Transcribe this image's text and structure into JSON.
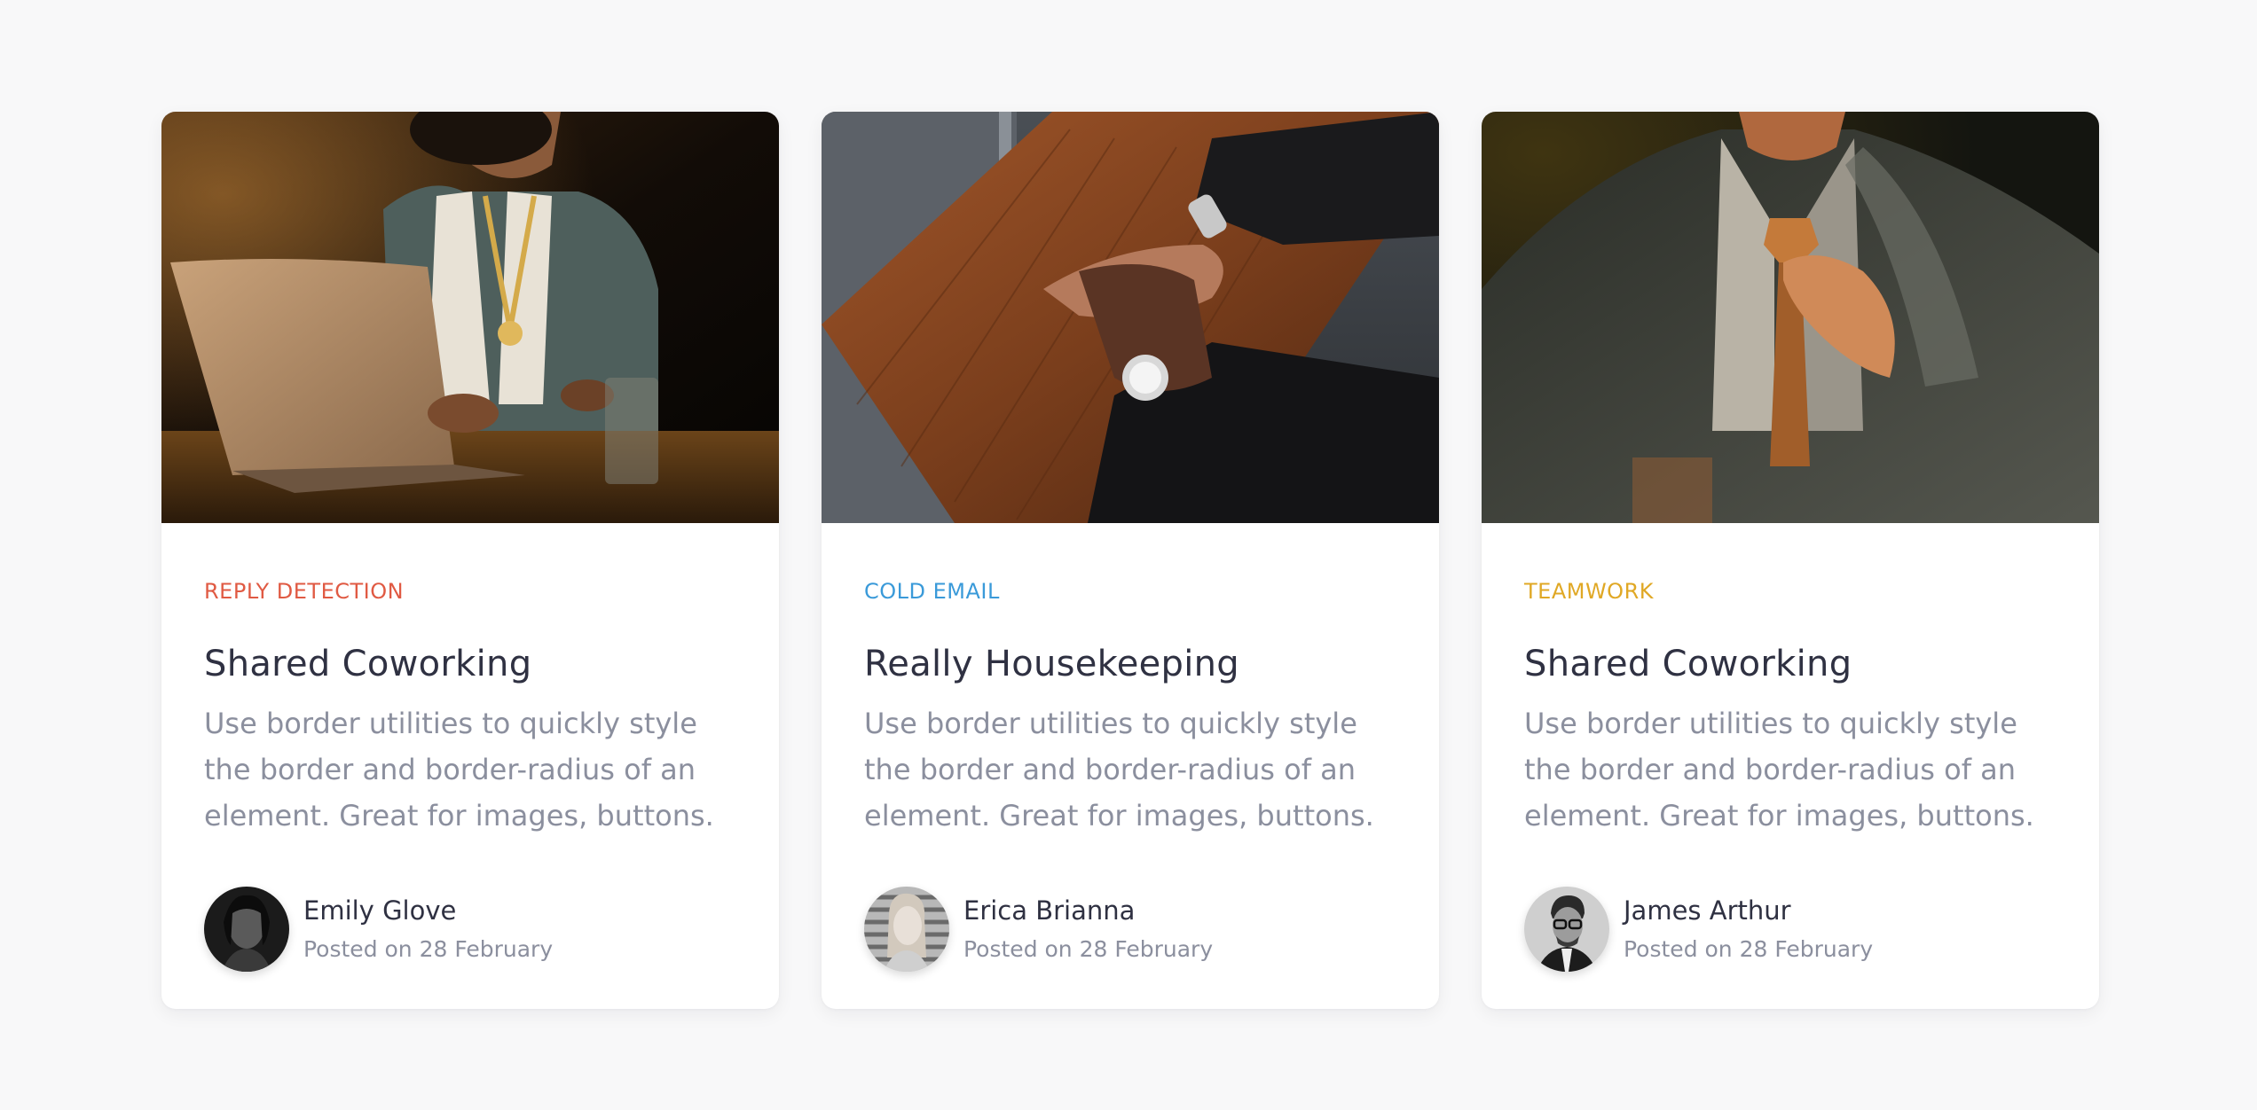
{
  "cards": [
    {
      "image": "woman-with-laptop-photo",
      "category": "REPLY DETECTION",
      "category_color": "#e05a43",
      "title": "Shared Coworking",
      "description": "Use border utilities to quickly style the border and border-radius of an element. Great for images, buttons.",
      "author": {
        "name": "Emily Glove",
        "date": "Posted on 28 February",
        "avatar": "woman-portrait-avatar"
      }
    },
    {
      "image": "handshake-on-wooden-table-photo",
      "category": "COLD EMAIL",
      "category_color": "#3a9ad9",
      "title": "Really Housekeeping",
      "description": "Use border utilities to quickly style the border and border-radius of an element. Great for images, buttons.",
      "author": {
        "name": "Erica Brianna",
        "date": "Posted on 28 February",
        "avatar": "woman-portrait-avatar"
      }
    },
    {
      "image": "man-adjusting-tie-photo",
      "category": "TEAMWORK",
      "category_color": "#e0a825",
      "title": "Shared Coworking",
      "description": "Use border utilities to quickly style the border and border-radius of an element. Great for images, buttons.",
      "author": {
        "name": "James Arthur",
        "date": "Posted on 28 February",
        "avatar": "man-with-glasses-avatar"
      }
    }
  ]
}
